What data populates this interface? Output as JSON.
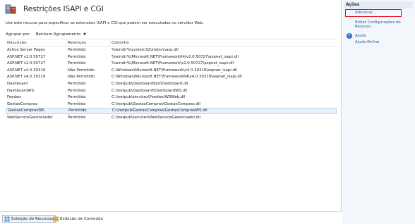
{
  "header": {
    "title": "Restrições ISAPI e CGI",
    "description": "Use este recurso para especificar as extensões ISAPI e CGI que podem ser executadas no servidor Web."
  },
  "group_by": {
    "label": "Agrupar por:",
    "value": "Nenhum Agrupamento"
  },
  "grid": {
    "columns": [
      "Descrição",
      "Restrição",
      "Caminho"
    ],
    "rows": [
      {
        "descricao": "Active Server Pages",
        "restricao": "Permitido",
        "caminho": "%windir%\\system32\\inetsrv\\asp.dll"
      },
      {
        "descricao": "ASP.NET v2.0.50727",
        "restricao": "Permitido",
        "caminho": "%windir%\\Microsoft.NET\\Framework64\\v2.0.50727\\aspnet_isapi.dll"
      },
      {
        "descricao": "ASP.NET v2.0.50727",
        "restricao": "Permitido",
        "caminho": "%windir%\\Microsoft.NET\\Framework\\v2.0.50727\\aspnet_isapi.dll"
      },
      {
        "descricao": "ASP.NET v4.0.30319",
        "restricao": "Não Permitido",
        "caminho": "C:\\Windows\\Microsoft.NET\\Framework\\v4.0.30319\\aspnet_isapi.dll"
      },
      {
        "descricao": "ASP.NET v4.0.30319",
        "restricao": "Não Permitido",
        "caminho": "C:\\Windows\\Microsoft.NET\\Framework64\\v4.0.30319\\aspnet_isapi.dll"
      },
      {
        "descricao": "Dashboard",
        "restricao": "Permitido",
        "caminho": "C:\\inetpub\\Dashboard\\bin\\Dashboard.dll"
      },
      {
        "descricao": "DashboardWS",
        "restricao": "Permitido",
        "caminho": "C:\\inetpub\\Dashboard\\DashboardWS.dll"
      },
      {
        "descricao": "Feedws",
        "restricao": "Permitido",
        "caminho": "C:\\inetpub\\services\\Feedws\\WSWeb.dll"
      },
      {
        "descricao": "GestaoCompras",
        "restricao": "Permitido",
        "caminho": "C:\\inetpub\\GestaoCompras\\GestaoCompras.dll"
      },
      {
        "descricao": "GestaoComprasWS",
        "restricao": "Permitido",
        "caminho": "C:\\inetpub\\GestaoCompras\\GestaoComprasWS.dll"
      },
      {
        "descricao": "WebServiceGerenciador",
        "restricao": "Permitido",
        "caminho": "C:\\inetpub\\services\\WebServiceGerenciador.dll"
      }
    ],
    "selected_row": 9
  },
  "actions": {
    "title": "Ações",
    "add": "Adicionar...",
    "edit": "Editar Configurações de Recurso...",
    "help": "Ajuda",
    "online_help": "Ajuda Online"
  },
  "bottom_tabs": {
    "features_view": "Exibição de Recursos",
    "content_view": "Exibição de Conteúdo"
  },
  "icons": {
    "header": "isapi-cgi-icon",
    "help": "help-icon",
    "features_view": "features-view-icon",
    "content_view": "content-view-icon"
  },
  "colors": {
    "link": "#1f5fa8",
    "highlight_border": "#e0141e",
    "selected_row": "#e8f2fc"
  }
}
